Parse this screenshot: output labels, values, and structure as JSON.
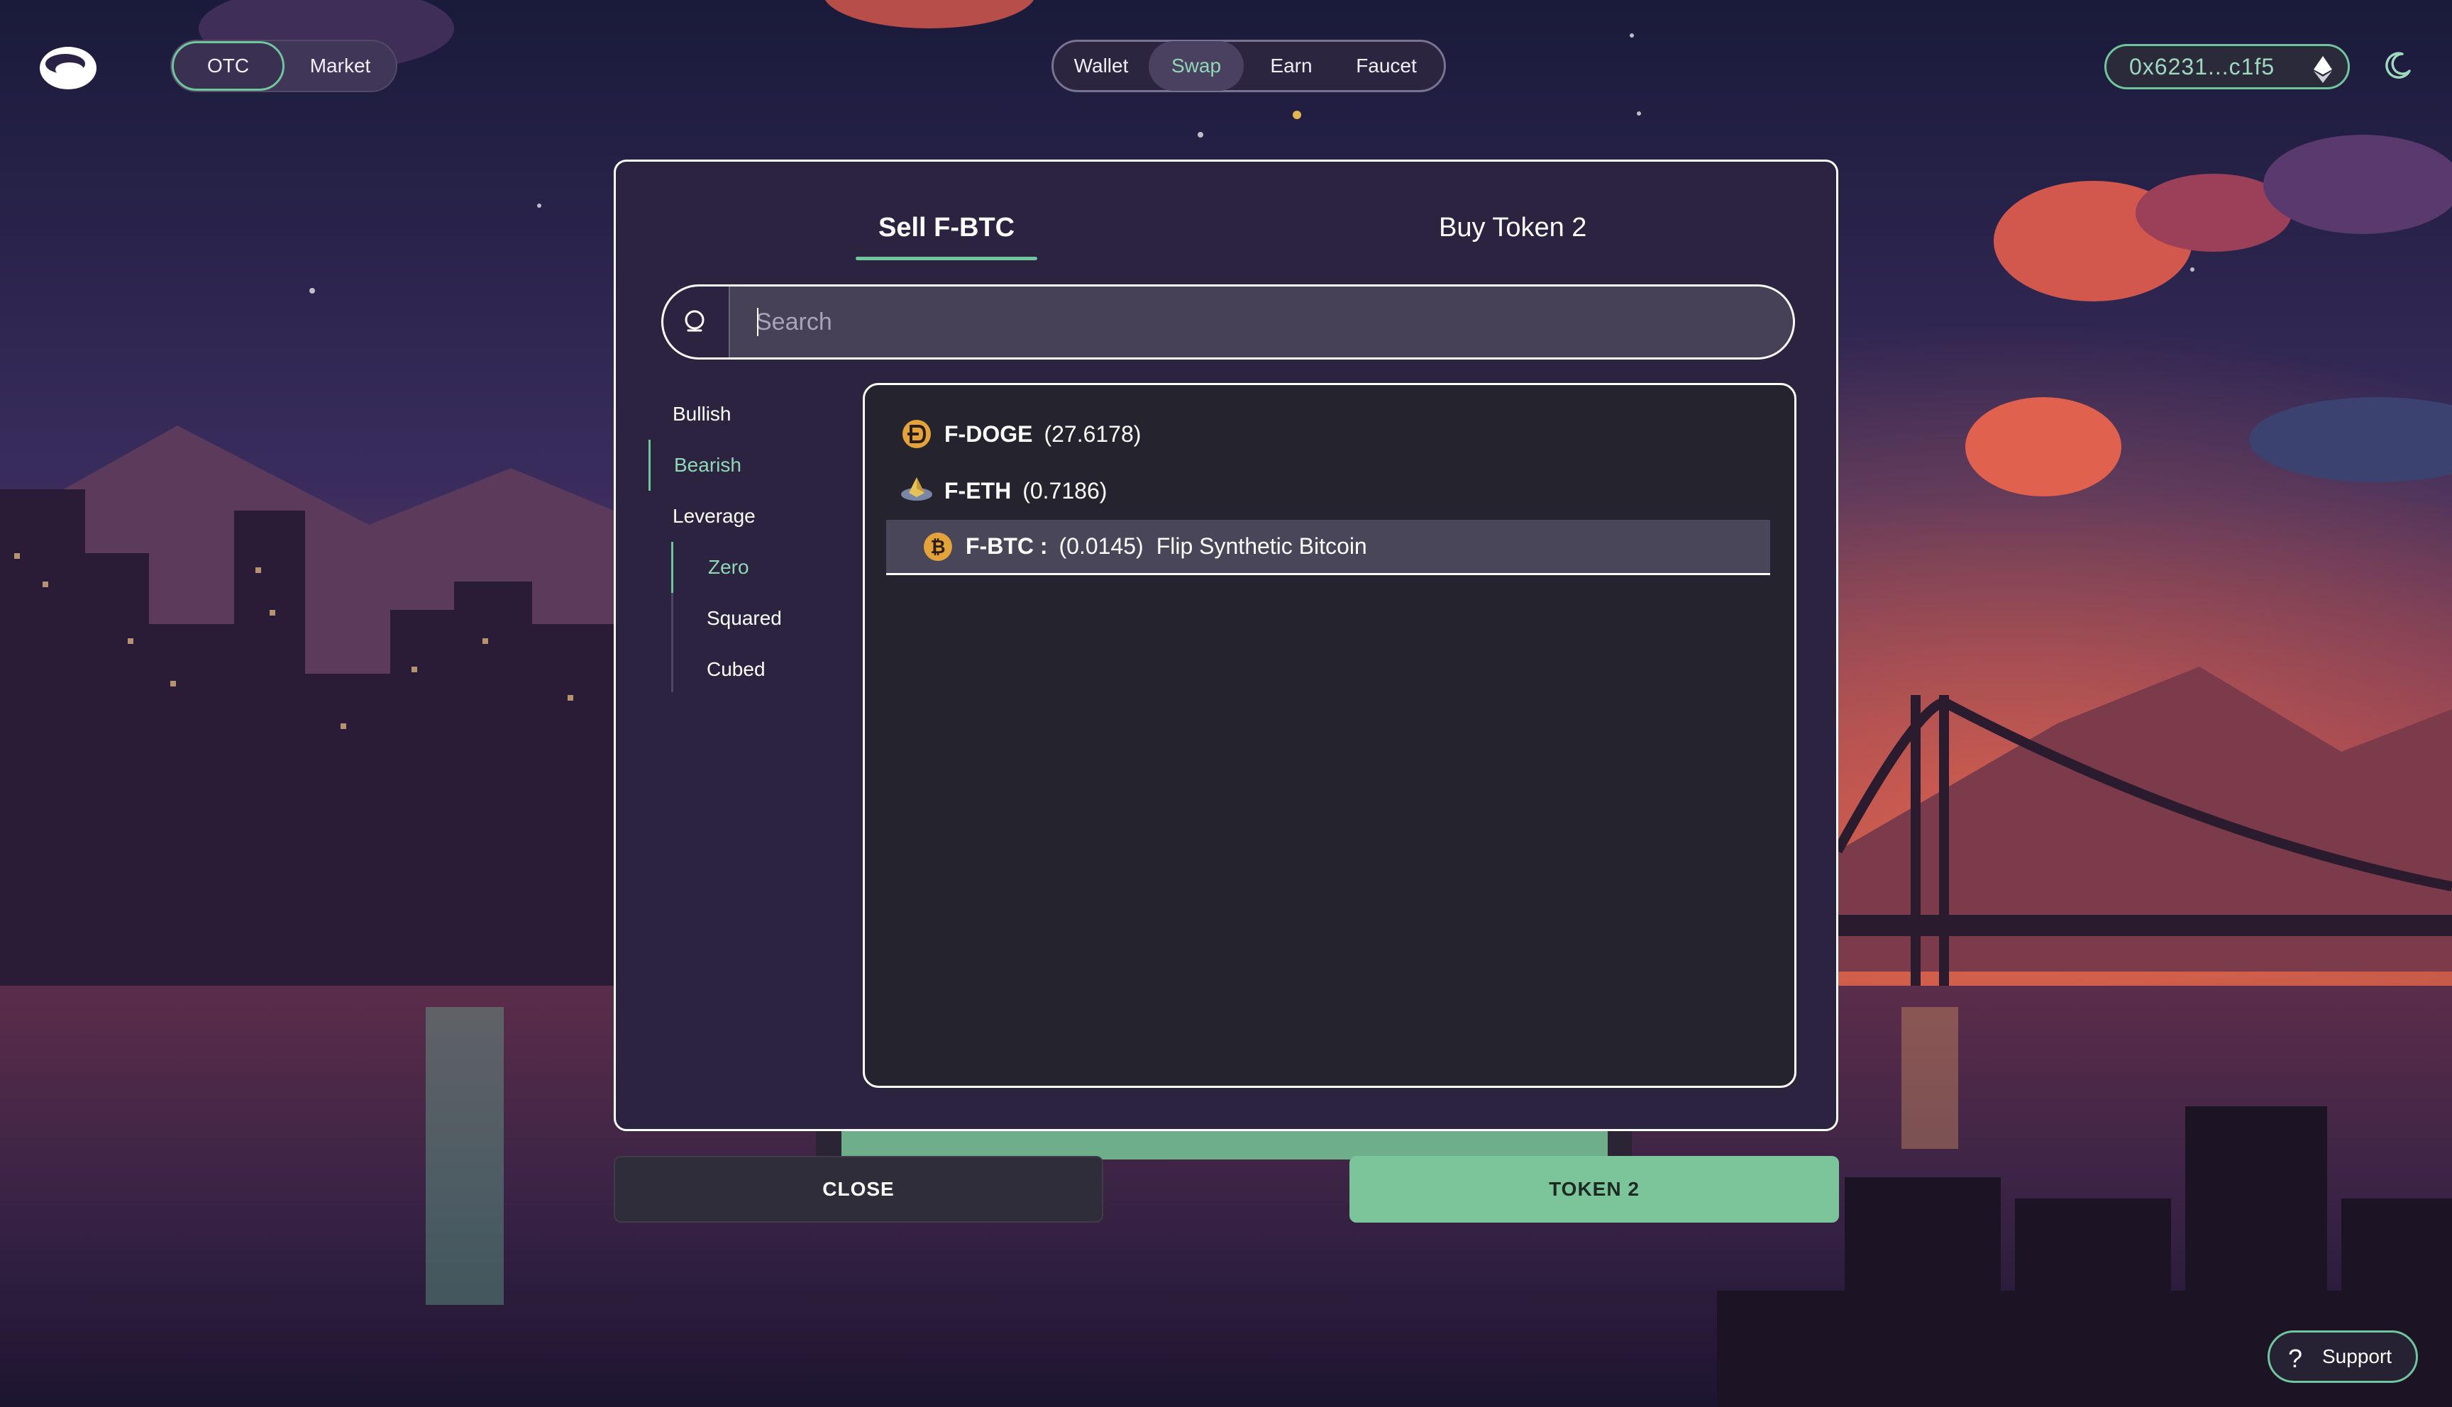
{
  "colors": {
    "accent_green": "#6fc69d",
    "active_text_green": "#8fd8b3",
    "panel": "#2b2340",
    "list_bg": "#24232e",
    "primary_button": "#7cc59b"
  },
  "topbar": {
    "logo_icon": "flip-logo-icon",
    "mode_toggle": [
      "OTC",
      "Market"
    ],
    "nav": [
      {
        "label": "Wallet",
        "active": false
      },
      {
        "label": "Swap",
        "active": true
      },
      {
        "label": "Earn",
        "active": false
      },
      {
        "label": "Faucet",
        "active": false
      }
    ],
    "wallet_address": "0x6231...c1f5",
    "network_icon": "ethereum-icon",
    "theme_icon": "moon-icon"
  },
  "modal": {
    "tabs": [
      {
        "label": "Sell F-BTC",
        "active": true
      },
      {
        "label": "Buy Token 2",
        "active": false
      }
    ],
    "search": {
      "placeholder": "Search",
      "value": ""
    },
    "categories": [
      {
        "label": "Bullish",
        "active": false
      },
      {
        "label": "Bearish",
        "active": true
      },
      {
        "label": "Leverage",
        "active": false
      },
      {
        "label": "Zero",
        "active": true
      },
      {
        "label": "Squared",
        "active": false
      },
      {
        "label": "Cubed",
        "active": false
      }
    ],
    "tokens": [
      {
        "symbol": "F-DOGE",
        "balance": "(27.6178)",
        "name": "",
        "icon": "doge-coin-icon",
        "selected": false
      },
      {
        "symbol": "F-ETH",
        "balance": "(0.7186)",
        "name": "",
        "icon": "eth-coin-icon",
        "selected": false
      },
      {
        "symbol": "F-BTC :",
        "balance": "(0.0145)",
        "name": "Flip Synthetic Bitcoin",
        "icon": "btc-coin-icon",
        "selected": true
      }
    ]
  },
  "buttons": {
    "close_label": "CLOSE",
    "token_label": "TOKEN 2"
  },
  "support": {
    "label": "Support",
    "icon": "question-icon"
  }
}
